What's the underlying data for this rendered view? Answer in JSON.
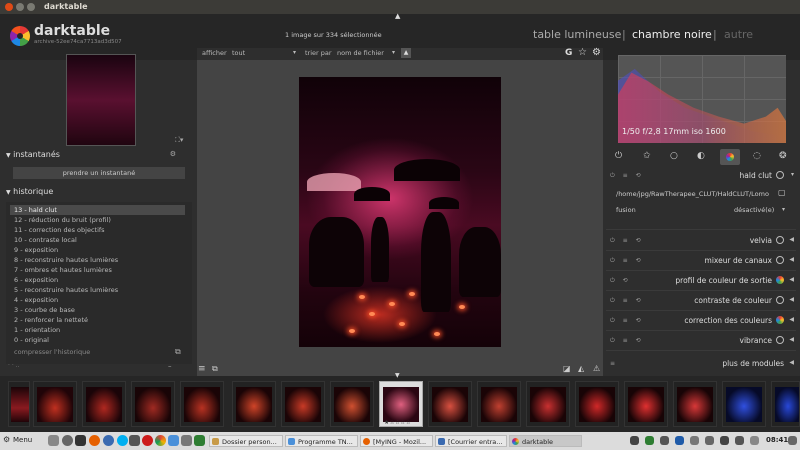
{
  "window": {
    "title": "darktable"
  },
  "header": {
    "app_name": "darktable",
    "version": "archive-52ee74ca7713ad3d507",
    "selection_status": "1 image sur 334 sélectionnée",
    "views": {
      "lighttable": "table lumineuse",
      "separator": "|",
      "darkroom": "chambre noire",
      "other": "autre"
    }
  },
  "toolbar": {
    "show_label": "afficher",
    "show_value": "tout",
    "sort_label": "trier par",
    "sort_value": "nom de fichier",
    "grouping_glyph": "G",
    "star_glyph": "☆",
    "gear_glyph": "⚙"
  },
  "left": {
    "snapshots": {
      "title": "instantanés",
      "button": "prendre un instantané"
    },
    "history": {
      "title": "historique",
      "items": [
        "13 - hald clut",
        "12 - réduction du bruit (profil)",
        "11 - correction des objectifs",
        "10 - contraste local",
        "9 - exposition",
        "8 - reconstruire hautes lumières",
        "7 - ombres et hautes lumières",
        "6 - exposition",
        "5 - reconstruire hautes lumières",
        "4 - exposition",
        "3 - courbe de base",
        "2 - renforcer la netteté",
        "1 - orientation",
        "0 - original"
      ],
      "selected_index": 0,
      "compress": "compresser l'historique"
    }
  },
  "right": {
    "histogram_info": "1/50 f/2,8 17mm iso 1600",
    "module_tab_icons": [
      "power-icon",
      "star-icon",
      "circle-icon",
      "half-circle-icon",
      "color-wheel-icon",
      "drop-icon",
      "aperture-icon"
    ],
    "hald_clut": {
      "name": "hald clut",
      "file_path": "/home/jpg/RawTherapee_CLUT/HaldCLUT/Lomo",
      "merge_label": "fusion",
      "merge_value": "désactivé(e)"
    },
    "modules": [
      "velvia",
      "mixeur de canaux",
      "profil de couleur de sortie",
      "contraste de couleur",
      "correction des couleurs",
      "vibrance"
    ],
    "more_modules": "plus de modules"
  },
  "filmstrip": {
    "count": 16,
    "selected_index": 8
  },
  "taskbar": {
    "menu": "Menu",
    "tasks": [
      "Dossier person...",
      "Programme TN...",
      "[MyING - Mozil...",
      "[Courrier entra...",
      "darktable"
    ],
    "clock": "08:41"
  },
  "colors": {
    "accent": "#e23c6e",
    "panel": "#2e2e2e",
    "background": "#333333"
  }
}
